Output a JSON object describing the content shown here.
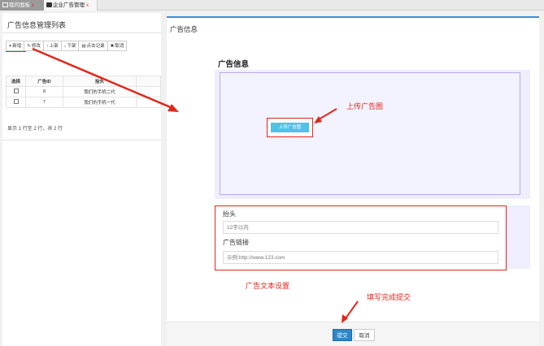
{
  "tabs": [
    {
      "label": "我的面板",
      "close": "x"
    },
    {
      "label": "企业广告管理",
      "close": "x"
    }
  ],
  "list_panel": {
    "title": "广告信息管理列表",
    "toolbar": [
      {
        "icon": "+",
        "label": "新增"
      },
      {
        "icon": "✎",
        "label": "修改"
      },
      {
        "icon": "↑",
        "label": "上架"
      },
      {
        "icon": "↓",
        "label": "下架"
      },
      {
        "icon": "▤",
        "label": "点击记录"
      },
      {
        "icon": "✖",
        "label": "取消"
      }
    ],
    "columns": [
      "选择",
      "广告ID",
      "抬头",
      ""
    ],
    "rows": [
      {
        "id": "8",
        "title": "我们的手机二代"
      },
      {
        "id": "7",
        "title": "我们的手机一代"
      }
    ],
    "footer": "显示 1 行至 2 行，共 2 行"
  },
  "form": {
    "window_title": "广告信息",
    "section_title": "广告信息",
    "upload_button": "上传广告图",
    "title_label": "抬头",
    "title_placeholder": "12字以内",
    "link_label": "广告链接",
    "link_placeholder": "示例:http://www.123.com",
    "submit": "提交",
    "cancel": "取消"
  },
  "annotations": {
    "upload": "上传广告图",
    "text_settings": "广告文本设置",
    "submit_hint": "填写完成提交"
  },
  "colors": {
    "annotation": "#e0271c",
    "primary": "#2f86c7",
    "upload_button": "#4ec3e8"
  }
}
